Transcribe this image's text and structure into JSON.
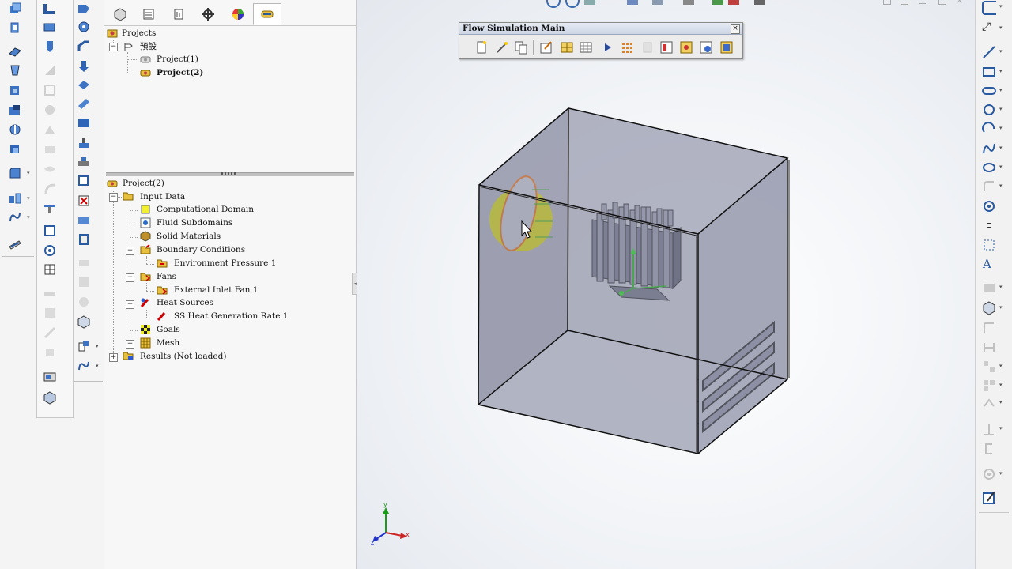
{
  "panel_top": {
    "root_label": "Projects",
    "config_label": "預設",
    "project1_label": "Project(1)",
    "project2_label": "Project(2)"
  },
  "panel_bottom": {
    "root_label": "Project(2)",
    "input_data": "Input Data",
    "computational_domain": "Computational Domain",
    "fluid_subdomains": "Fluid Subdomains",
    "solid_materials": "Solid Materials",
    "boundary_conditions": "Boundary Conditions",
    "environment_pressure": "Environment Pressure 1",
    "fans": "Fans",
    "external_inlet_fan": "External Inlet Fan 1",
    "heat_sources": "Heat Sources",
    "ss_heat_generation": "SS Heat Generation Rate 1",
    "goals": "Goals",
    "mesh": "Mesh",
    "results": "Results (Not loaded)"
  },
  "flow_toolbar": {
    "title": "Flow Simulation Main",
    "close": "×"
  },
  "triad": {
    "x": "x",
    "y": "y",
    "z": "z"
  },
  "colors": {
    "model_face": "#9598a8",
    "fan_highlight": "#c8c800",
    "selection_orange": "#d2691e",
    "active_tab": "#ffffff"
  }
}
